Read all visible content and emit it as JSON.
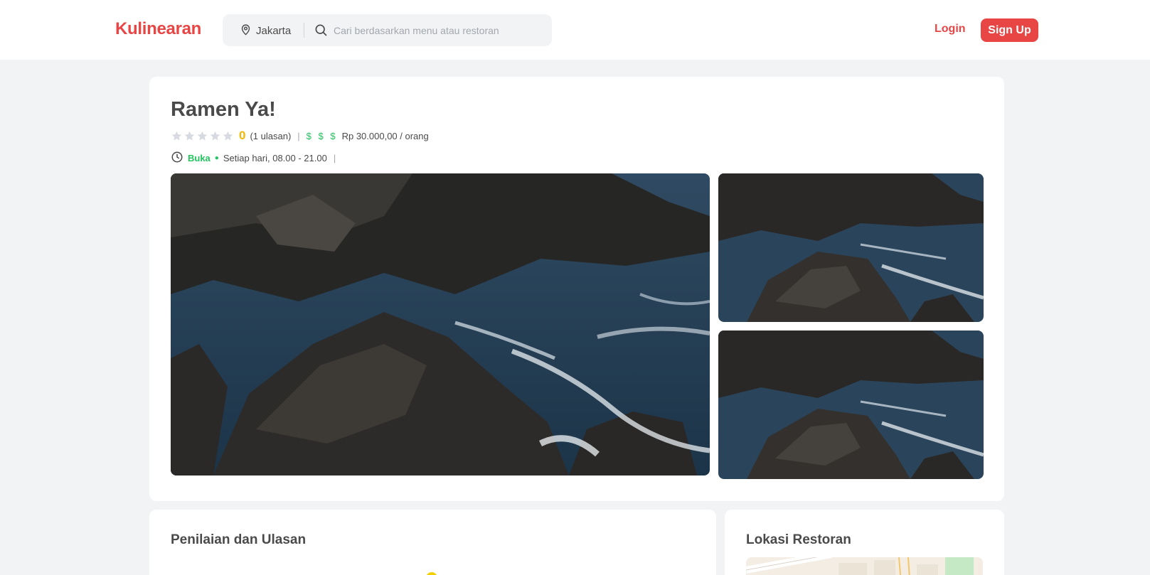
{
  "navbar": {
    "brand": "Kulinearan",
    "location": "Jakarta",
    "search_placeholder": "Cari berdasarkan menu atau restoran",
    "login_label": "Login",
    "signup_label": "Sign Up"
  },
  "restaurant": {
    "name": "Ramen Ya!",
    "rating": "0",
    "rating_stars": 0,
    "review_count": "(1 ulasan)",
    "price_level": "$ $ $",
    "price_text": "Rp 30.000,00 / orang",
    "status": "Buka",
    "hours": "Setiap hari, 08.00 - 21.00"
  },
  "sections": {
    "reviews_title": "Penilaian dan Ulasan",
    "location_title": "Lokasi Restoran"
  },
  "colors": {
    "accent": "#e84545",
    "open": "#22c55e",
    "rating": "#f2b705",
    "background": "#f2f3f5"
  },
  "icons": [
    "location-pin-icon",
    "search-icon",
    "star-icon",
    "clock-icon"
  ]
}
